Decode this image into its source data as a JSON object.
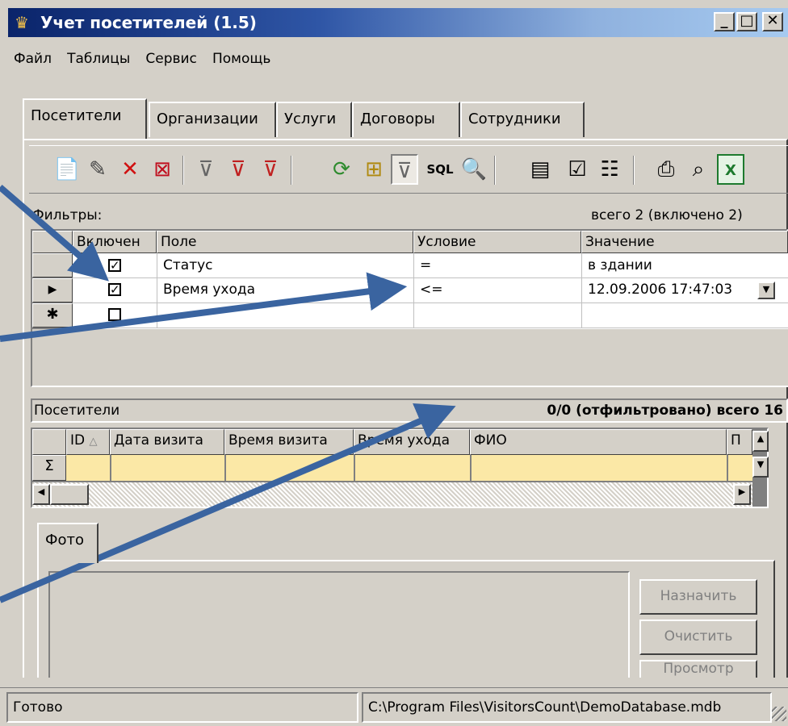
{
  "window": {
    "title": "Учет посетителей (1.5)",
    "minimize_glyph": "_",
    "maximize_glyph": "□",
    "close_glyph": "✕"
  },
  "menu": [
    "Файл",
    "Таблицы",
    "Сервис",
    "Помощь"
  ],
  "tabs": [
    "Посетители",
    "Организации",
    "Услуги",
    "Договоры",
    "Сотрудники"
  ],
  "toolbar": {
    "icons": [
      {
        "name": "new-record-icon",
        "glyph": "📄"
      },
      {
        "name": "edit-icon",
        "glyph": "✎"
      },
      {
        "name": "delete-icon",
        "glyph": "✕"
      },
      {
        "name": "delete-all-icon",
        "glyph": "⊠"
      },
      {
        "name": "filter-add-icon",
        "glyph": "⊽"
      },
      {
        "name": "filter-remove-icon",
        "glyph": "⊽"
      },
      {
        "name": "filter-clear-icon",
        "glyph": "⊽"
      },
      {
        "name": "refresh-icon",
        "glyph": "⟳"
      },
      {
        "name": "tree-icon",
        "glyph": "⊞"
      },
      {
        "name": "filter-apply-icon",
        "glyph": "⊽"
      },
      {
        "name": "sql-icon",
        "glyph": "SQL"
      },
      {
        "name": "find-icon",
        "glyph": "🔍"
      },
      {
        "name": "field-add-icon",
        "glyph": "▤"
      },
      {
        "name": "properties-icon",
        "glyph": "☑"
      },
      {
        "name": "settings-icon",
        "glyph": "☷"
      },
      {
        "name": "print-icon",
        "glyph": "⎙"
      },
      {
        "name": "print-preview-icon",
        "glyph": "⌕"
      },
      {
        "name": "excel-export-icon",
        "glyph": "X"
      }
    ]
  },
  "filters": {
    "label": "Фильтры:",
    "summary": "всего 2 (включено 2)",
    "columns": [
      "Включен",
      "Поле",
      "Условие",
      "Значение"
    ],
    "rows": [
      {
        "indicator": "",
        "enabled": true,
        "field": "Статус",
        "condition": "=",
        "value": "в здании"
      },
      {
        "indicator": "▶",
        "enabled": true,
        "field": "Время ухода",
        "condition": "<=",
        "value": "12.09.2006 17:47:03"
      },
      {
        "indicator": "✱",
        "enabled": false,
        "field": "",
        "condition": "",
        "value": ""
      }
    ]
  },
  "visitors": {
    "label": "Посетители",
    "summary": "0/0 (отфильтровано)  всего 16",
    "columns": [
      "ID",
      "Дата визита",
      "Время визита",
      "Время ухода",
      "ФИО",
      "П"
    ],
    "sort_glyph": "△",
    "sum_glyph": "Σ"
  },
  "photo": {
    "tab": "Фото",
    "buttons": [
      "Назначить",
      "Очистить",
      "Просмотр"
    ]
  },
  "statusbar": {
    "status": "Готово",
    "path": "C:\\Program Files\\VisitorsCount\\DemoDatabase.mdb"
  },
  "annotation_color": "#3a64a0"
}
